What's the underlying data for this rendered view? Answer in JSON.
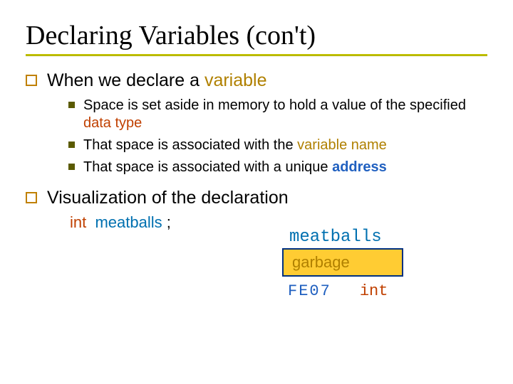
{
  "title": "Declaring Variables (con't)",
  "p1": {
    "intro_before": "When we declare a ",
    "intro_kw": "variable",
    "sub1_a": "Space is set aside in memory to hold a value of the specified ",
    "sub1_kw": "data type",
    "sub2_a": "That space is associated with the ",
    "sub2_kw": "variable name",
    "sub3_a": "That space is associated with a unique ",
    "sub3_kw": "address"
  },
  "p2": {
    "text": "Visualization of the declaration",
    "decl_type": "int",
    "decl_id": "meatballs",
    "decl_semi": ";"
  },
  "viz": {
    "label": "meatballs",
    "box": "garbage",
    "addr": "FE07",
    "type": "int"
  }
}
